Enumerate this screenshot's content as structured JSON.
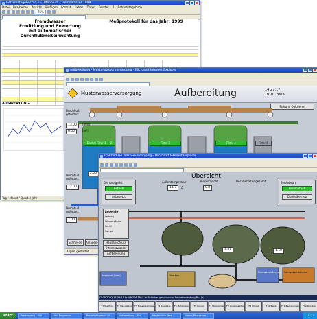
{
  "win_excel": {
    "title": "Betriebstagebuch 4.6 - Uffenheim - Fremdwasser 1999",
    "menu": [
      "Datei",
      "Bearbeiten",
      "Ansicht",
      "Einfügen",
      "Format",
      "Extras",
      "Daten",
      "Fenster",
      "?",
      "Betriebstagebuch"
    ],
    "zoom": "75%",
    "doc_title1": "Fremdwasser",
    "doc_title2": "Ermittlung und Bewertung",
    "doc_title3": "mit automatischer Durchflußmeßeinrichtung",
    "protokoll": "Meßprotokoll für das Jahr: 1999",
    "auswertung": "AUSWERTUNG",
    "sheet_tab": "Tag / Monat / Quart. / Jahr"
  },
  "win_aufbereitung": {
    "title": "Aufbereitung - Musterwasserversorgung - Microsoft Internet Explorer",
    "company": "Musterwasserversorgung",
    "heading": "Aufbereitung",
    "time": "14:27:17",
    "date": "10.10.2003",
    "stoerung": "Störung Quittieren",
    "filter1": "Enthei-Filter 1 + 2",
    "filter2": "Filter 3",
    "filter3": "Filter 4",
    "filter4": "Filter 5",
    "filter_speicher": "Filter 6",
    "flow1_label": "Durchfluß gefördert",
    "flow1_value": "13.00",
    "flow1_unit": "[m³/h]",
    "flow2_value": "6.50",
    "flow2_unit": "[m³]",
    "flow3_label": "Durchfluß gefördert",
    "flow3_value": "12.00",
    "flow4_label": "Durchfluß gefördert",
    "flow4_value": "7.00",
    "status": "Applet gestartet",
    "nav": [
      "Startseite",
      "Anlagen-Übersicht",
      "Brunnen"
    ],
    "filter_box1": "2.00",
    "filter_box2": "7.00",
    "filter_box3": "7.00"
  },
  "win_uebersicht": {
    "title": "Fraktaldiele Wasserversorgung - Microsoft Internet Explorer",
    "heading": "Übersicht",
    "anlage_label": "Die Anlage ist",
    "anlage_status": "Betrieb",
    "unbesetzt": "unbesetzt",
    "aussentemp_label": "Außentemperatur",
    "aussentemp_value": "11.7",
    "aussentemp_unit": "°C",
    "messschacht": "Messschacht",
    "hochbehaelter": "Hochbehälter gesamt",
    "betriebsart": "Betriebsart",
    "handbetrieb": "Handbetrieb",
    "dunkelbetrieb": "Dunkelbetrieb",
    "speicher_label": "Speicher Wasser",
    "legend_title": "Legende",
    "legend_items": [
      "Leitung",
      "Wasserzähler",
      "Ventil",
      "Pumpe"
    ],
    "hausanschluss": "Hausanschluss",
    "trinkwasser": "Ortsnetzwasser",
    "ueberwachungsstation": "Überwachungsstation",
    "aufbereitung_btn": "Aufbereitung",
    "reservoir_left": "Reservoir (klein)",
    "reservoir_mid": "Rückwasserbecken",
    "reservoir_right": "Reinwasserbehälter",
    "tank2_value": "3.47",
    "tank3_value": "1.10",
    "flow_value": "0.8",
    "leitung": "Drucksteigerungsschacht",
    "filterbau": "Filterbau",
    "schieber": "Schieber Gruppe",
    "status_footer": "22.08.2002  15:39:15 Fr  WHG06 SNLF Nr Schieber geschlossen  Betriebsmeldung:Bu. (a)",
    "fkeys": [
      "F1\nSys Prog",
      "F2\nMessglieder",
      "F3\nMessergebnisse",
      "F4\nRegelung",
      "F5\nMeldungen",
      "F6\nKurven",
      "F7\nÜbersichten",
      "F8\nAnzeigeseiten",
      "F9\nUhrzeit",
      "F10\nTrends",
      "F11\nBedienungen",
      "F12\nDrucken"
    ],
    "status": "Applet gestartet"
  },
  "taskbar": {
    "start": "start",
    "tasks": [
      "Posteingang - Out",
      "Mail Programm",
      "Betriebstagebuch 4",
      "Aufbereitung - Mu",
      "Fraktaldiele Was",
      "Adobe Photoshop"
    ],
    "clock": "14:27"
  }
}
